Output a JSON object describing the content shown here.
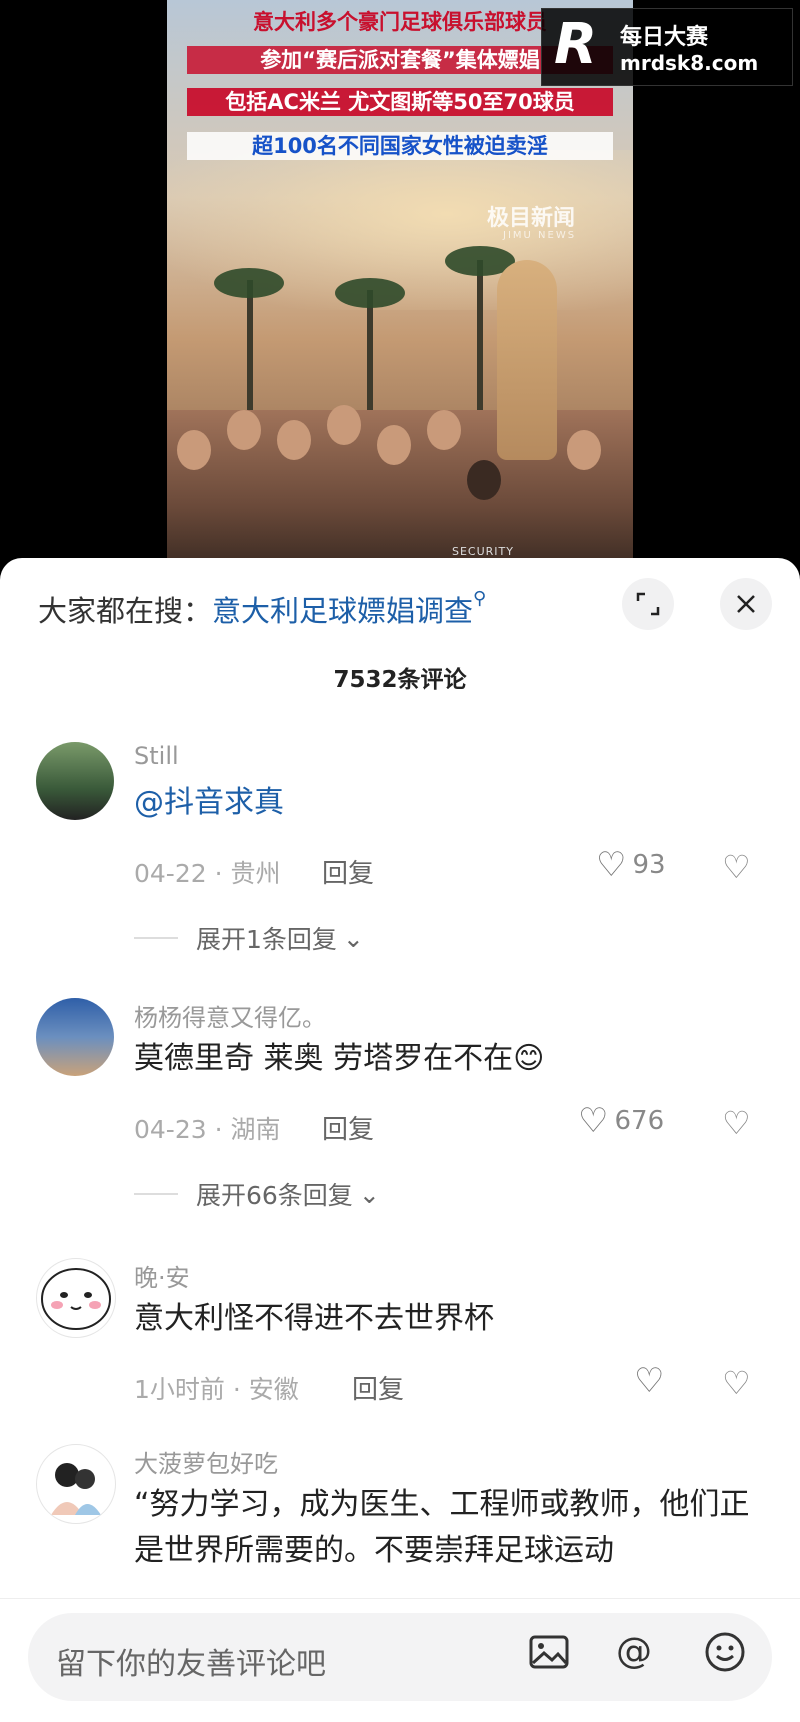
{
  "video": {
    "headline_1": "意大利多个豪门足球俱乐部球员",
    "headline_2": "参加“赛后派对套餐”集体嫖娼",
    "headline_3": "包括AC米兰 尤文图斯等50至70球员",
    "headline_4": "超100名不同国家女性被迫卖淫",
    "news_watermark": "极目新闻",
    "news_watermark_sub": "JIMU NEWS",
    "security_text": "SECURITY"
  },
  "logo": {
    "mark": "R",
    "name": "每日大赛",
    "url": "mrdsk8.com"
  },
  "panel": {
    "search_label": "大家都在搜：",
    "search_term": "意大利足球嫖娼调查",
    "comment_count": "7532条评论",
    "expand_icon": "expand-icon",
    "close_icon": "close-icon"
  },
  "comments": [
    {
      "user": "Still",
      "text": "@抖音求真",
      "date_loc": "04-22 · 贵州",
      "reply": "回复",
      "likes": "93",
      "more": "展开1条回复"
    },
    {
      "user": "杨杨得意又得亿。",
      "text": "莫德里奇 莱奥 劳塔罗在不在😊",
      "date_loc": "04-23 · 湖南",
      "reply": "回复",
      "likes": "676",
      "more": "展开66条回复"
    },
    {
      "user": "晚·安",
      "text": "意大利怪不得进不去世界杯",
      "date_loc": "1小时前 · 安徽",
      "reply": "回复",
      "likes": ""
    },
    {
      "user": "大菠萝包好吃",
      "text": "“努力学习，成为医生、工程师或教师，他们正是世界所需要的。不要崇拜足球运动"
    }
  ],
  "input": {
    "placeholder": "留下你的友善评论吧"
  }
}
